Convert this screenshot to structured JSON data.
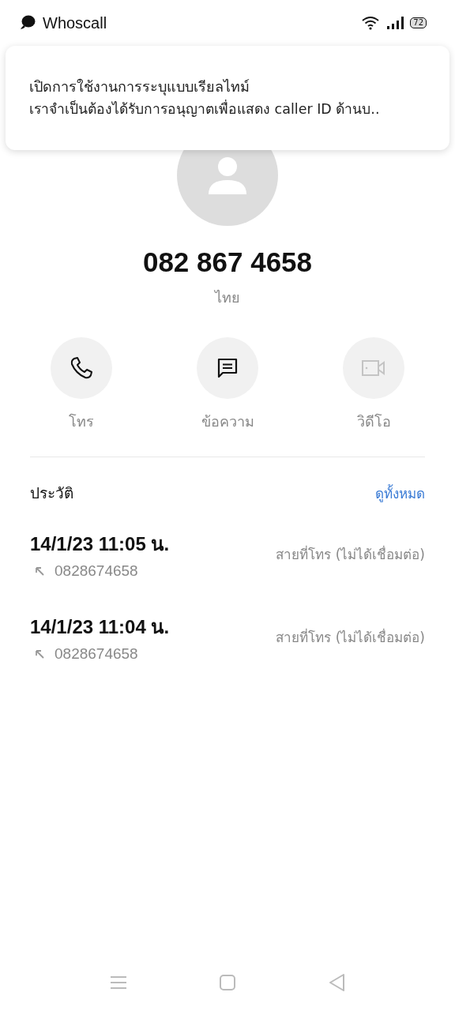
{
  "status_bar": {
    "app_name": "Whoscall",
    "battery": "72"
  },
  "notification": {
    "title": "เปิดการใช้งานการระบุแบบเรียลไทม์",
    "body": "เราจำเป็นต้องได้รับการอนุญาตเพื่อแสดง caller ID ด้านบ.."
  },
  "contact": {
    "number": "082 867 4658",
    "country": "ไทย"
  },
  "actions": [
    {
      "kind": "call",
      "label": "โทร",
      "disabled": false
    },
    {
      "kind": "message",
      "label": "ข้อความ",
      "disabled": false
    },
    {
      "kind": "video",
      "label": "วิดีโอ",
      "disabled": true
    }
  ],
  "history": {
    "title": "ประวัติ",
    "view_all": "ดูทั้งหมด",
    "entries": [
      {
        "time": "14/1/23 11:05 น.",
        "number": "0828674658",
        "status": "สายที่โทร (ไม่ได้เชื่อมต่อ)"
      },
      {
        "time": "14/1/23 11:04 น.",
        "number": "0828674658",
        "status": "สายที่โทร (ไม่ได้เชื่อมต่อ)"
      }
    ]
  }
}
